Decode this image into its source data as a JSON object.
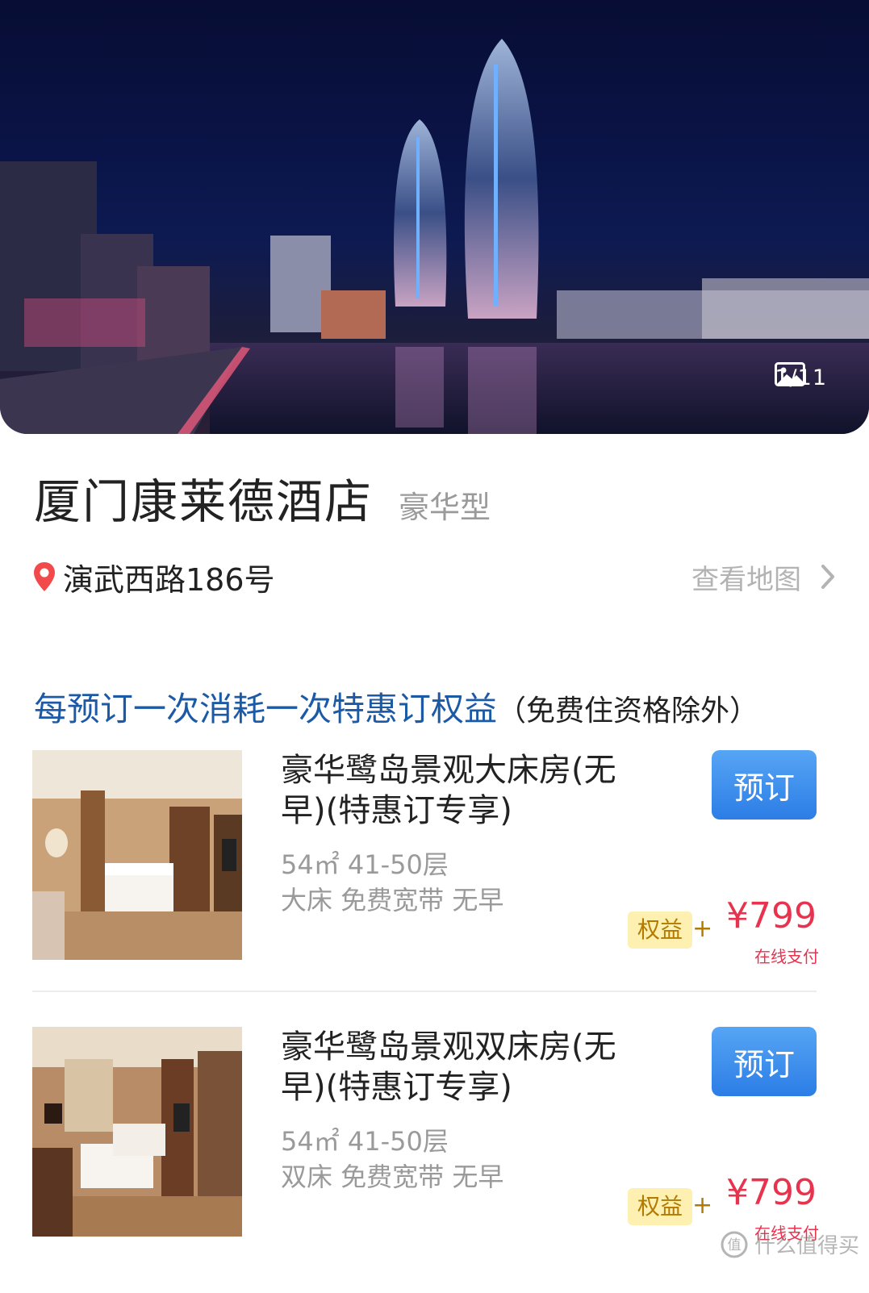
{
  "gallery": {
    "counter": "1/11"
  },
  "hotel": {
    "name": "厦门康莱德酒店",
    "type": "豪华型",
    "address": "演武西路186号",
    "map_link": "查看地图"
  },
  "notice": {
    "main": "每预订一次消耗一次特惠订权益",
    "sub": "（免费住资格除外）"
  },
  "rooms": [
    {
      "name": "豪华鹭岛景观大床房(无早)(特惠订专享)",
      "area_floor": "54㎡ 41-50层",
      "features": "大床 免费宽带 无早",
      "book_label": "预订",
      "perk_label": "权益",
      "perk_plus": "+",
      "price": "¥799",
      "pay_note": "在线支付"
    },
    {
      "name": "豪华鹭岛景观双床房(无早)(特惠订专享)",
      "area_floor": "54㎡ 41-50层",
      "features": "双床 免费宽带 无早",
      "book_label": "预订",
      "perk_label": "权益",
      "perk_plus": "+",
      "price": "¥799",
      "pay_note": "在线支付"
    }
  ],
  "watermark": "什么值得买",
  "colors": {
    "accent_blue": "#1c5aa6",
    "button_blue": "#2c7de6",
    "price_red": "#e8334f",
    "perk_bg": "#fdf0b0"
  }
}
